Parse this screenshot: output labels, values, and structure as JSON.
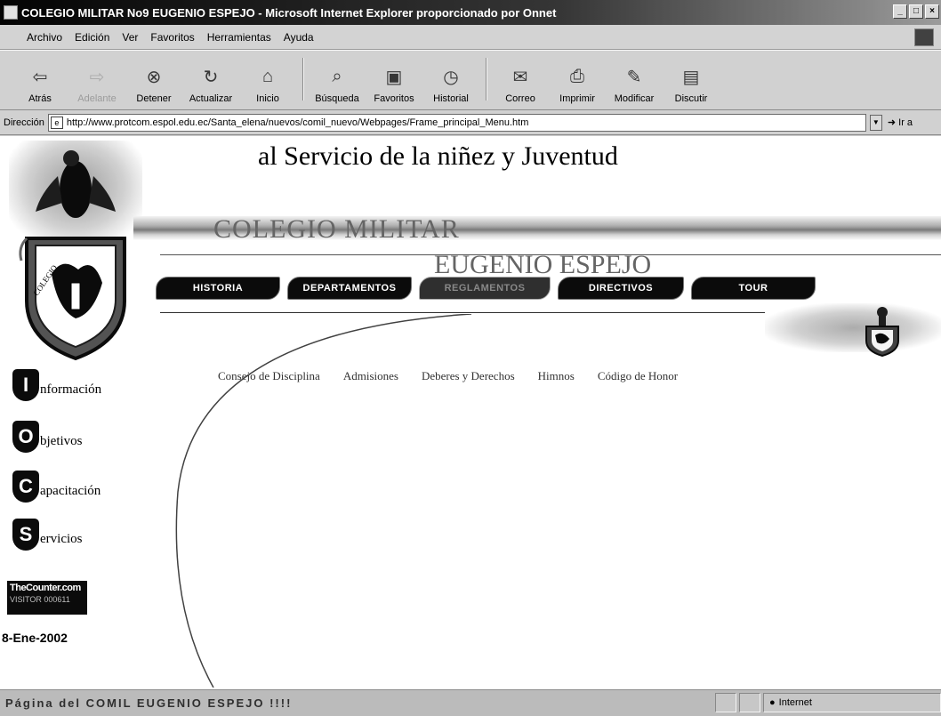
{
  "window": {
    "title": "COLEGIO MILITAR No9 EUGENIO ESPEJO - Microsoft Internet Explorer proporcionado por Onnet",
    "controls": [
      "_",
      "□",
      "×"
    ]
  },
  "menubar": [
    "Archivo",
    "Edición",
    "Ver",
    "Favoritos",
    "Herramientas",
    "Ayuda"
  ],
  "toolbar": [
    {
      "label": "Atrás",
      "icon": "back-arrow-icon",
      "glyph": "⇦"
    },
    {
      "label": "Adelante",
      "icon": "forward-arrow-icon",
      "glyph": "⇨"
    },
    {
      "label": "Detener",
      "icon": "stop-icon",
      "glyph": "⊗"
    },
    {
      "label": "Actualizar",
      "icon": "refresh-icon",
      "glyph": "↻"
    },
    {
      "label": "Inicio",
      "icon": "home-icon",
      "glyph": "⌂"
    },
    {
      "label": "Búsqueda",
      "icon": "search-icon",
      "glyph": "⌕"
    },
    {
      "label": "Favoritos",
      "icon": "favorites-icon",
      "glyph": "▣"
    },
    {
      "label": "Historial",
      "icon": "history-icon",
      "glyph": "◷"
    },
    {
      "label": "Correo",
      "icon": "mail-icon",
      "glyph": "✉"
    },
    {
      "label": "Imprimir",
      "icon": "print-icon",
      "glyph": "⎙"
    },
    {
      "label": "Modificar",
      "icon": "edit-icon",
      "glyph": "✎"
    },
    {
      "label": "Discutir",
      "icon": "discuss-icon",
      "glyph": "▤"
    }
  ],
  "address": {
    "label": "Dirección",
    "url": "http://www.protcom.espol.edu.ec/Santa_elena/nuevos/comil_nuevo/Webpages/Frame_principal_Menu.htm",
    "go_label": "Ir a"
  },
  "page": {
    "headline": "al Servicio de la niñez y Juventud",
    "school_line1": "COLEGIO MILITAR",
    "school_line2": "EUGENIO ESPEJO",
    "nav_tabs": [
      {
        "label": "Historia",
        "active": false
      },
      {
        "label": "Departamentos",
        "active": false
      },
      {
        "label": "Reglamentos",
        "active": true
      },
      {
        "label": "Directivos",
        "active": false
      },
      {
        "label": "Tour",
        "active": false
      }
    ],
    "submenu": [
      "Consejo de Disciplina",
      "Admisiones",
      "Deberes y Derechos",
      "Himnos",
      "Código de Honor"
    ],
    "sidebar": [
      {
        "letter": "I",
        "rest": "nformación"
      },
      {
        "letter": "O",
        "rest": "bjetivos"
      },
      {
        "letter": "C",
        "rest": "apacitación"
      },
      {
        "letter": "S",
        "rest": "ervicios"
      }
    ],
    "counter": {
      "brand": "TheCounter.com",
      "label": "VISITOR",
      "value": "000611"
    },
    "date": "8-Ene-2002",
    "crest_text": "COLEGIO"
  },
  "statusbar": {
    "text": "Página del COMIL EUGENIO ESPEJO !!!!",
    "zone": "Internet"
  }
}
